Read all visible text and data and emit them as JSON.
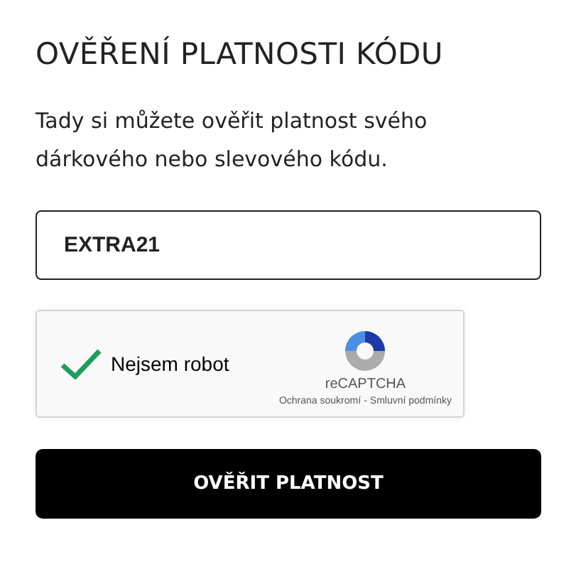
{
  "title": "OVĚŘENÍ PLATNOSTI KÓDU",
  "description": "Tady si můžete ověřit platnost svého dárkového nebo slevového kódu.",
  "code_field": {
    "value": "EXTRA21"
  },
  "captcha": {
    "label": "Nejsem robot",
    "checked": true,
    "brand": "reCAPTCHA",
    "privacy_link": "Ochrana soukromí",
    "separator": "-",
    "terms_link": "Smluvní podmínky"
  },
  "submit_button": "OVĚŘIT PLATNOST"
}
